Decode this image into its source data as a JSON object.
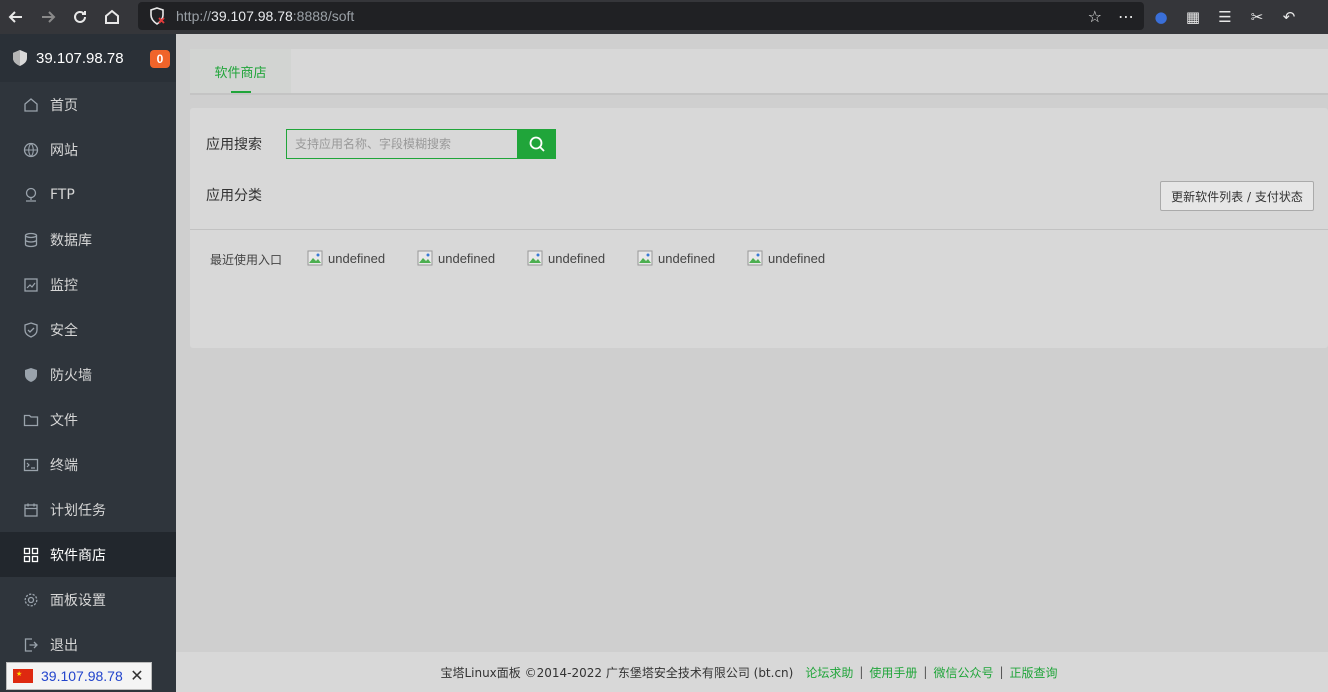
{
  "browser": {
    "url_host": "39.107.98.78",
    "url_rest": ":8888/soft",
    "url_scheme": "http://"
  },
  "sidebar": {
    "server_ip": "39.107.98.78",
    "badge_count": "0",
    "items": [
      {
        "label": "首页",
        "icon": "home-icon"
      },
      {
        "label": "网站",
        "icon": "globe-icon"
      },
      {
        "label": "FTP",
        "icon": "ftp-icon"
      },
      {
        "label": "数据库",
        "icon": "database-icon"
      },
      {
        "label": "监控",
        "icon": "monitor-icon"
      },
      {
        "label": "安全",
        "icon": "shield-icon"
      },
      {
        "label": "防火墙",
        "icon": "firewall-icon"
      },
      {
        "label": "文件",
        "icon": "folder-icon"
      },
      {
        "label": "终端",
        "icon": "terminal-icon"
      },
      {
        "label": "计划任务",
        "icon": "calendar-icon"
      },
      {
        "label": "软件商店",
        "icon": "apps-grid-icon",
        "active": true
      },
      {
        "label": "面板设置",
        "icon": "gear-icon"
      },
      {
        "label": "退出",
        "icon": "logout-icon"
      }
    ]
  },
  "main": {
    "tab_label": "软件商店",
    "search_label": "应用搜索",
    "search_placeholder": "支持应用名称、字段模糊搜索",
    "category_label": "应用分类",
    "update_button": "更新软件列表 / 支付状态",
    "recent_label": "最近使用入口",
    "recent_items": [
      "undefined",
      "undefined",
      "undefined",
      "undefined",
      "undefined"
    ]
  },
  "footer": {
    "copyright": "宝塔Linux面板 ©2014-2022 广东堡塔安全技术有限公司 (bt.cn)",
    "links": [
      "论坛求助",
      "使用手册",
      "微信公众号",
      "正版查询"
    ]
  },
  "status_tip": {
    "ip": "39.107.98.78"
  },
  "colors": {
    "accent": "#20a53a",
    "sidebar_bg": "#2f353c",
    "badge": "#f0642a"
  }
}
